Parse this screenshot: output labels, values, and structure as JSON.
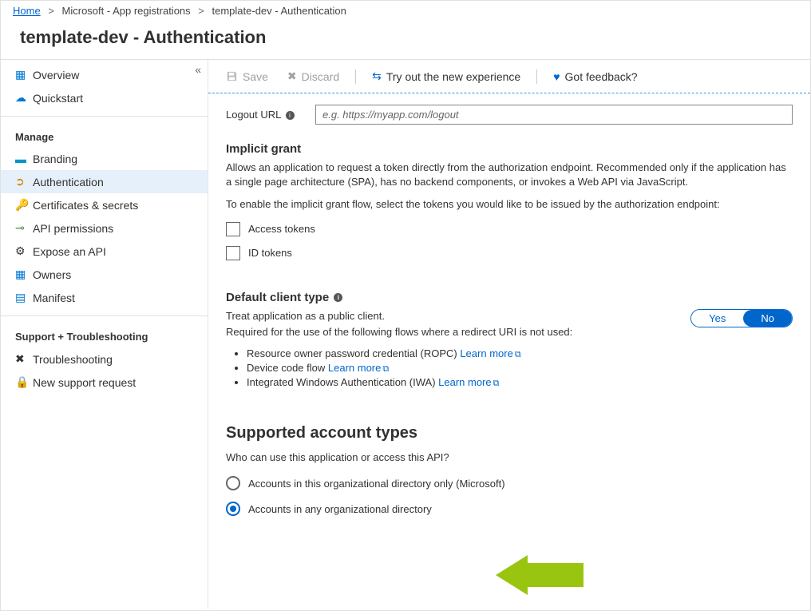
{
  "breadcrumb": {
    "home": "Home",
    "level1": "Microsoft - App registrations",
    "level2": "template-dev - Authentication"
  },
  "page_title": "template-dev - Authentication",
  "sidebar": {
    "items_top": [
      {
        "label": "Overview"
      },
      {
        "label": "Quickstart"
      }
    ],
    "group_manage": "Manage",
    "items_manage": [
      {
        "label": "Branding"
      },
      {
        "label": "Authentication"
      },
      {
        "label": "Certificates & secrets"
      },
      {
        "label": "API permissions"
      },
      {
        "label": "Expose an API"
      },
      {
        "label": "Owners"
      },
      {
        "label": "Manifest"
      }
    ],
    "group_support": "Support + Troubleshooting",
    "items_support": [
      {
        "label": "Troubleshooting"
      },
      {
        "label": "New support request"
      }
    ]
  },
  "toolbar": {
    "save": "Save",
    "discard": "Discard",
    "tryout": "Try out the new experience",
    "feedback": "Got feedback?"
  },
  "logout": {
    "label": "Logout URL",
    "placeholder": "e.g. https://myapp.com/logout"
  },
  "implicit": {
    "heading": "Implicit grant",
    "desc1": "Allows an application to request a token directly from the authorization endpoint. Recommended only if the application has a single page architecture (SPA), has no backend components, or invokes a Web API via JavaScript.",
    "desc2": "To enable the implicit grant flow, select the tokens you would like to be issued by the authorization endpoint:",
    "access": "Access tokens",
    "id": "ID tokens"
  },
  "default_client": {
    "heading": "Default client type",
    "line1": "Treat application as a public client.",
    "line2": "Required for the use of the following flows where a redirect URI is not used:",
    "yes": "Yes",
    "no": "No",
    "bullets": [
      {
        "text": "Resource owner password credential (ROPC) ",
        "link": "Learn more"
      },
      {
        "text": "Device code flow ",
        "link": "Learn more"
      },
      {
        "text": "Integrated Windows Authentication (IWA) ",
        "link": "Learn more"
      }
    ]
  },
  "supported": {
    "heading": "Supported account types",
    "desc": "Who can use this application or access this API?",
    "opt1": "Accounts in this organizational directory only (Microsoft)",
    "opt2": "Accounts in any organizational directory"
  }
}
